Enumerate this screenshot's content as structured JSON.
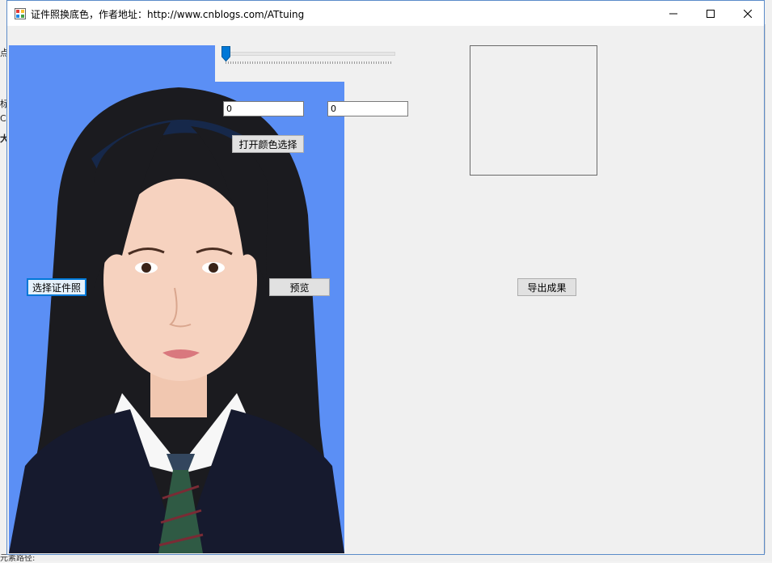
{
  "window": {
    "title": "证件照换底色，作者地址：http://www.cnblogs.com/ATtuing",
    "controls": {
      "minimize": "—",
      "maximize": "☐",
      "close": "✕"
    }
  },
  "slider": {
    "value": 0,
    "min": 0,
    "max": 100
  },
  "inputs": {
    "value_a": "0",
    "value_b": "0"
  },
  "buttons": {
    "open_color": "打开颜色选择",
    "select_photo": "选择证件照",
    "preview": "预览",
    "export": "导出成果"
  },
  "photo": {
    "background_color": "#5b8ff5"
  },
  "background_fragments": {
    "left": [
      "点",
      "标",
      "C",
      "大"
    ],
    "bottom": "元素路径: "
  }
}
